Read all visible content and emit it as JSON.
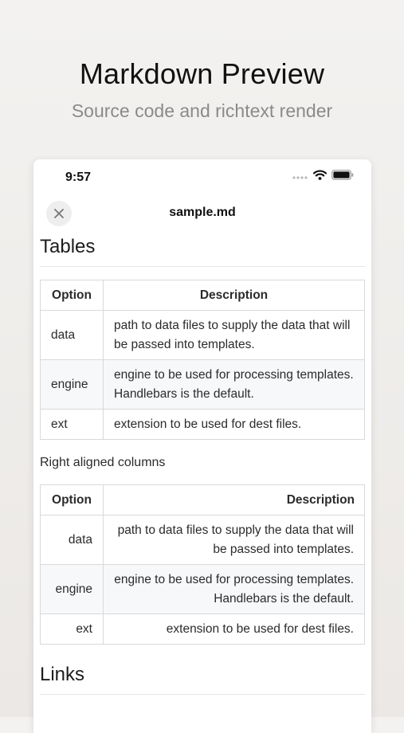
{
  "hero": {
    "title": "Markdown Preview",
    "subtitle": "Source code and richtext render"
  },
  "status_bar": {
    "time": "9:57"
  },
  "nav": {
    "title": "sample.md"
  },
  "document": {
    "tables_heading": "Tables",
    "table1": {
      "headers": [
        "Option",
        "Description"
      ],
      "rows": [
        [
          "data",
          "path to data files to supply the data that will be passed into templates."
        ],
        [
          "engine",
          "engine to be used for processing templates. Handlebars is the default."
        ],
        [
          "ext",
          "extension to be used for dest files."
        ]
      ]
    },
    "right_aligned_text": "Right aligned columns",
    "table2": {
      "headers": [
        "Option",
        "Description"
      ],
      "rows": [
        [
          "data",
          "path to data files to supply the data that will be passed into templates."
        ],
        [
          "engine",
          "engine to be used for processing templates. Handlebars is the default."
        ],
        [
          "ext",
          "extension to be used for dest files."
        ]
      ]
    },
    "links_heading": "Links"
  },
  "icons": {
    "close": "close-icon",
    "signal": "cellular-signal-icon",
    "wifi": "wifi-icon",
    "battery": "battery-icon"
  }
}
